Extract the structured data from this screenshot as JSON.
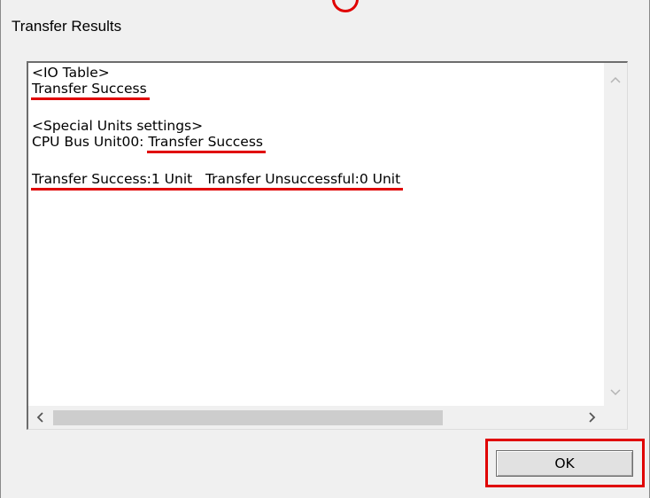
{
  "window": {
    "title": "Transfer Results"
  },
  "results": {
    "io_table_header": "<IO Table>",
    "io_table_status": "Transfer Success",
    "special_units_header": "<Special Units settings>",
    "cpu_bus_unit_label": "CPU Bus Unit00: ",
    "cpu_bus_unit_status": "Transfer Success",
    "summary": "Transfer Success:1 Unit   Transfer Unsuccessful:0 Unit"
  },
  "scrollbar": {
    "up_icon": "chevron-up-icon",
    "down_icon": "chevron-down-icon",
    "left_icon": "chevron-left-icon",
    "right_icon": "chevron-right-icon"
  },
  "buttons": {
    "ok_label": "OK"
  },
  "colors": {
    "highlight": "#e00000",
    "dialog_bg": "#f0f0f0"
  }
}
